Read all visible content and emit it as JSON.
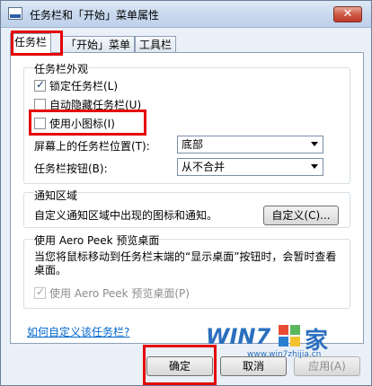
{
  "window": {
    "title": "任务栏和「开始」菜单属性",
    "close_label": "✕"
  },
  "tabs": [
    {
      "label": "任务栏",
      "active": true
    },
    {
      "label": "「开始」菜单",
      "active": false
    },
    {
      "label": "工具栏",
      "active": false
    }
  ],
  "appearance": {
    "title": "任务栏外观",
    "lock": {
      "label": "锁定任务栏(L)",
      "checked": true
    },
    "autohide": {
      "label": "自动隐藏任务栏(U)",
      "checked": false
    },
    "small_icons": {
      "label": "使用小图标(I)",
      "checked": false
    },
    "location": {
      "label": "屏幕上的任务栏位置(T):",
      "value": "底部"
    },
    "buttons": {
      "label": "任务栏按钮(B):",
      "value": "从不合并"
    }
  },
  "notification": {
    "title": "通知区域",
    "description": "自定义通知区域中出现的图标和通知。",
    "customize_label": "自定义(C)..."
  },
  "aero_peek": {
    "title": "使用 Aero Peek 预览桌面",
    "description": "当您将鼠标移动到任务栏末端的“显示桌面”按钮时，会暂时查看桌面。",
    "checkbox": {
      "label": "使用 Aero Peek 预览桌面(P)",
      "checked": true,
      "disabled": true
    }
  },
  "help_link": "如何自定义该任务栏?",
  "buttons": {
    "ok": "确定",
    "cancel": "取消",
    "apply": "应用(A)"
  },
  "watermark": {
    "text": "WIN7",
    "char": "家",
    "url": "www.win7zhijia.cn"
  },
  "colors": {
    "highlight": "#e50000",
    "link": "#0066cc",
    "accent": "#2b6fbe"
  }
}
